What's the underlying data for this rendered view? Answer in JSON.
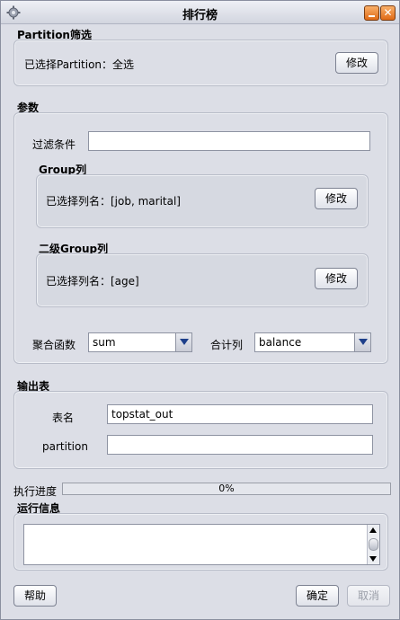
{
  "window": {
    "title": "排行榜"
  },
  "partition_section": {
    "label": "Partition筛选",
    "selected_text": "已选择Partition：全选",
    "modify_button": "修改"
  },
  "params_section": {
    "label": "参数",
    "filter_label": "过滤条件",
    "filter_value": "",
    "group": {
      "label": "Group列",
      "selected_text": "已选择列名：[job, marital]",
      "modify_button": "修改"
    },
    "secondary_group": {
      "label": "二级Group列",
      "selected_text": "已选择列名：[age]",
      "modify_button": "修改"
    },
    "agg_label": "聚合函数",
    "agg_value": "sum",
    "sum_col_label": "合计列",
    "sum_col_value": "balance"
  },
  "output_section": {
    "label": "输出表",
    "table_name_label": "表名",
    "table_name_value": "topstat_out",
    "partition_label": "partition",
    "partition_value": ""
  },
  "progress": {
    "label": "执行进度",
    "percent": 0,
    "text": "0%"
  },
  "run_info": {
    "label": "运行信息",
    "content": ""
  },
  "footer": {
    "help_button": "帮助",
    "ok_button": "确定",
    "cancel_button": "取消"
  },
  "colors": {
    "accent": "#6f8fd6",
    "window_button": "#e06a16",
    "background": "#dcdee6"
  }
}
